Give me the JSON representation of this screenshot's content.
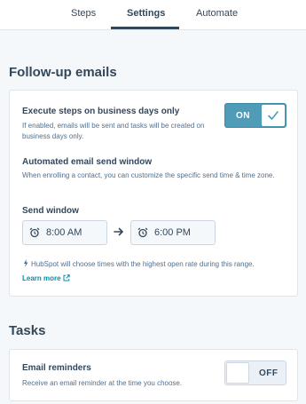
{
  "tabs": {
    "steps": "Steps",
    "settings": "Settings",
    "automate": "Automate",
    "active": "Settings"
  },
  "followup": {
    "title": "Follow-up emails",
    "business_days": {
      "label": "Execute steps on business days only",
      "help": "If enabled, emails will be sent and tasks will be created on business days only.",
      "toggle_label": "ON",
      "enabled": true
    },
    "send_window": {
      "label": "Automated email send window",
      "help": "When enrolling a contact, you can customize the specific send time & time zone.",
      "field_label": "Send window",
      "start_time": "8:00 AM",
      "end_time": "6:00 PM",
      "hint": "HubSpot will choose times with the highest open rate during this range.",
      "learn_more": "Learn more"
    }
  },
  "tasks": {
    "title": "Tasks",
    "email_reminders": {
      "label": "Email reminders",
      "help": "Receive an email reminder at the time you choose.",
      "toggle_label": "OFF",
      "enabled": false
    }
  },
  "colors": {
    "toggle_on": "#4e9cb7",
    "link": "#0091ae",
    "text": "#33475b"
  },
  "icons": [
    "alarm-clock-icon",
    "arrow-right-icon",
    "checkmark-icon",
    "sparkle-icon",
    "external-link-icon"
  ]
}
